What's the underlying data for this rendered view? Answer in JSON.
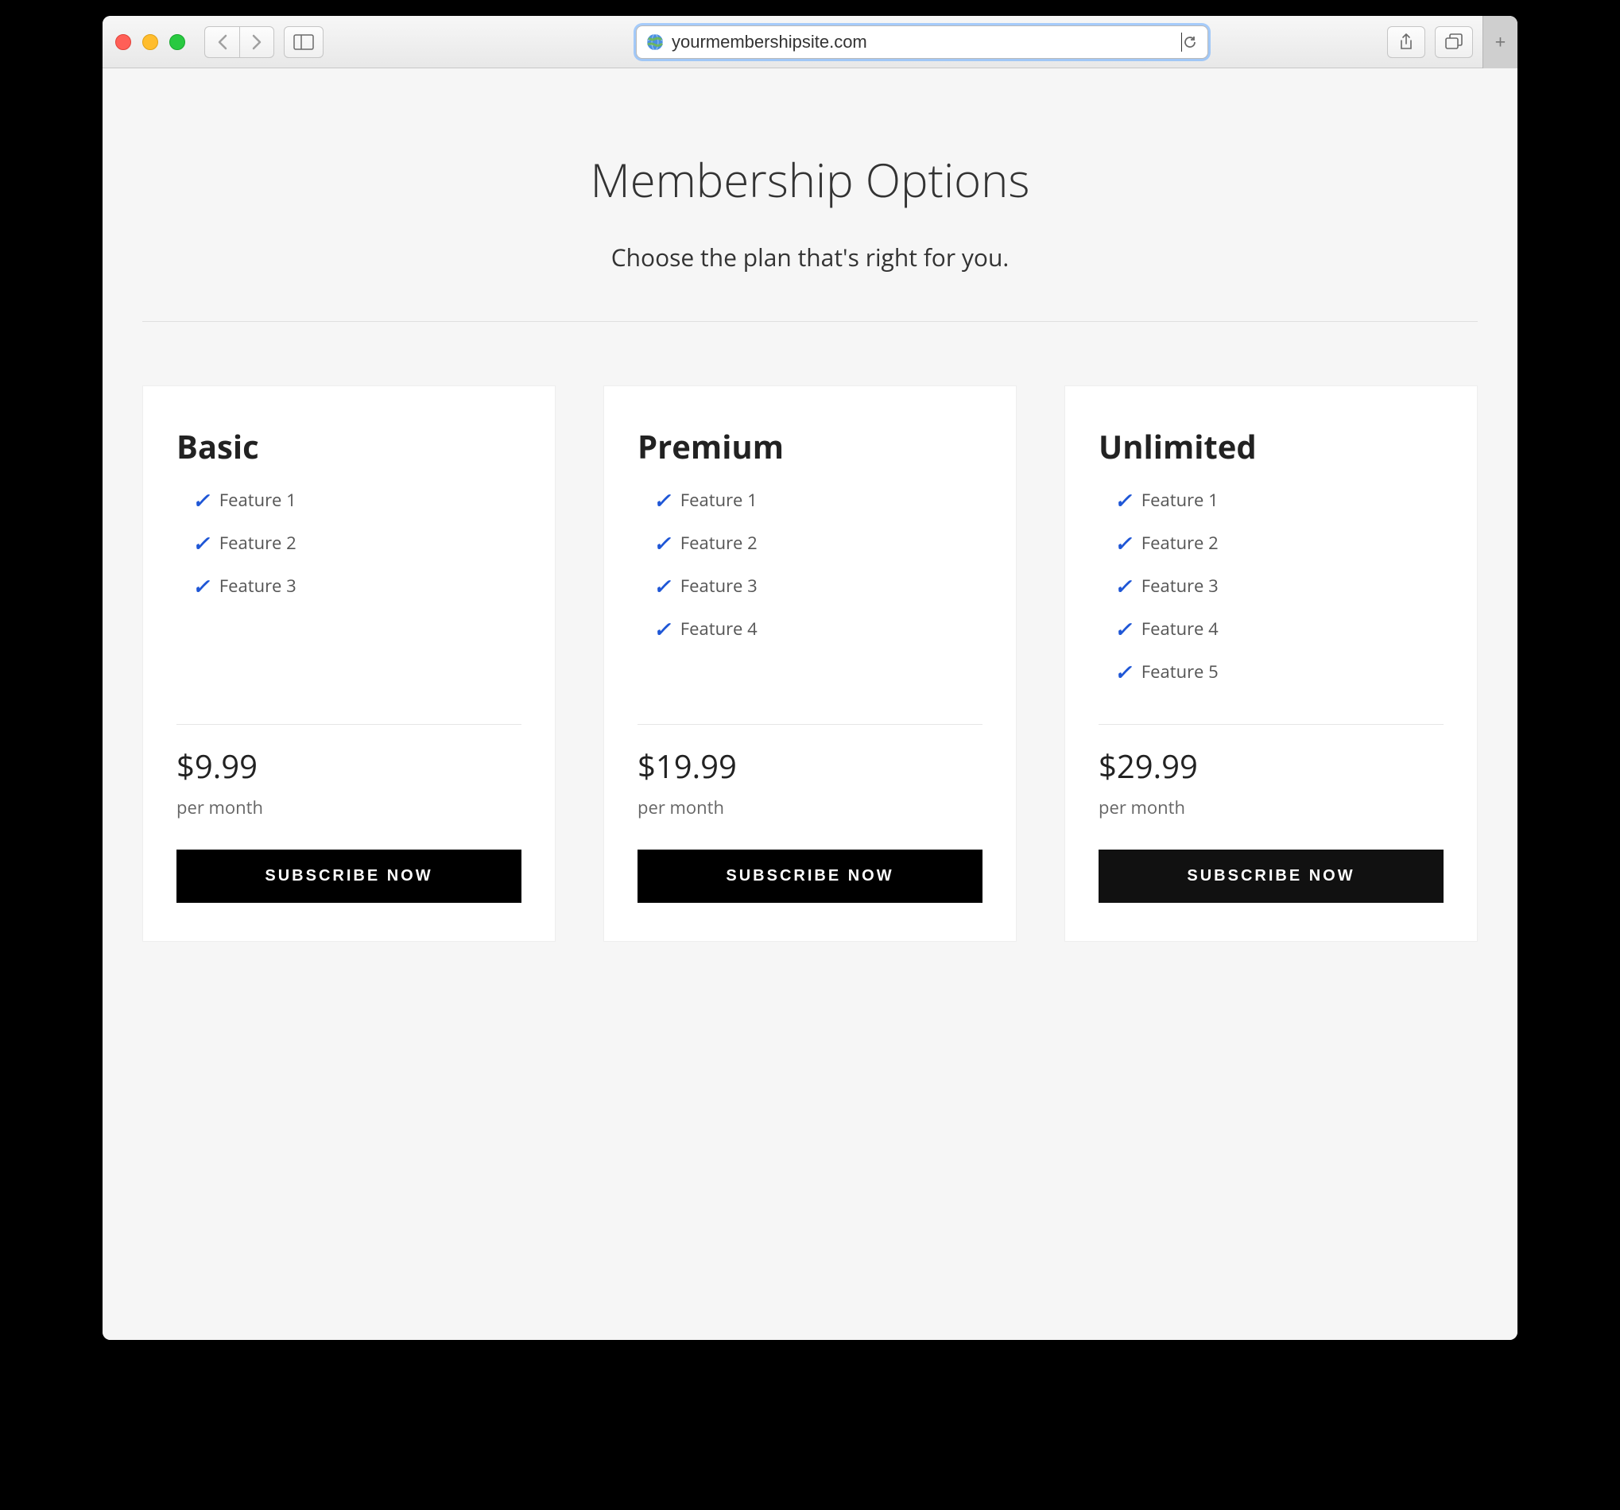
{
  "browser": {
    "url": "yourmembershipsite.com"
  },
  "header": {
    "title": "Membership Options",
    "subtitle": "Choose the plan that's right for you."
  },
  "plans": [
    {
      "name": "Basic",
      "features": [
        "Feature 1",
        "Feature 2",
        "Feature 3"
      ],
      "price": "$9.99",
      "period": "per month",
      "cta": "SUBSCRIBE NOW"
    },
    {
      "name": "Premium",
      "features": [
        "Feature 1",
        "Feature 2",
        "Feature 3",
        "Feature 4"
      ],
      "price": "$19.99",
      "period": "per month",
      "cta": "SUBSCRIBE NOW"
    },
    {
      "name": "Unlimited",
      "features": [
        "Feature 1",
        "Feature 2",
        "Feature 3",
        "Feature 4",
        "Feature 5"
      ],
      "price": "$29.99",
      "period": "per month",
      "cta": "SUBSCRIBE NOW"
    }
  ],
  "colors": {
    "accent_check": "#1e56d6",
    "button_bg": "#000000",
    "button_text": "#ffffff"
  }
}
